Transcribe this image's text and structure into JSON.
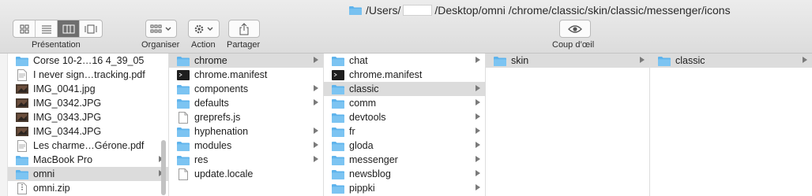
{
  "window": {
    "path_part1": "/Users/",
    "path_part2": "/Desktop/omni /chrome/classic/skin/classic/messenger/icons"
  },
  "toolbar": {
    "presentation_label": "Présentation",
    "organiser_label": "Organiser",
    "action_label": "Action",
    "partager_label": "Partager",
    "quicklook_label": "Coup d’œil"
  },
  "columns": [
    {
      "items": [
        {
          "label": "Corse 10-2…16 4_39_05",
          "icon": "folder-icon",
          "arrow": false,
          "selected": false
        },
        {
          "label": "I never sign…tracking.pdf",
          "icon": "pdf-icon",
          "arrow": false,
          "selected": false
        },
        {
          "label": "IMG_0041.jpg",
          "icon": "image-icon",
          "arrow": false,
          "selected": false
        },
        {
          "label": "IMG_0342.JPG",
          "icon": "image-icon",
          "arrow": false,
          "selected": false
        },
        {
          "label": "IMG_0343.JPG",
          "icon": "image-icon",
          "arrow": false,
          "selected": false
        },
        {
          "label": "IMG_0344.JPG",
          "icon": "image-icon",
          "arrow": false,
          "selected": false
        },
        {
          "label": "Les charme…Gérone.pdf",
          "icon": "pdf-icon",
          "arrow": false,
          "selected": false
        },
        {
          "label": "MacBook Pro",
          "icon": "folder-icon",
          "arrow": true,
          "selected": false
        },
        {
          "label": "omni",
          "icon": "folder-icon",
          "arrow": true,
          "selected": true
        },
        {
          "label": "omni.zip",
          "icon": "zip-icon",
          "arrow": false,
          "selected": false
        }
      ]
    },
    {
      "items": [
        {
          "label": "chrome",
          "icon": "folder-icon",
          "arrow": true,
          "selected": true
        },
        {
          "label": "chrome.manifest",
          "icon": "terminal-icon",
          "arrow": false,
          "selected": false
        },
        {
          "label": "components",
          "icon": "folder-icon",
          "arrow": true,
          "selected": false
        },
        {
          "label": "defaults",
          "icon": "folder-icon",
          "arrow": true,
          "selected": false
        },
        {
          "label": "greprefs.js",
          "icon": "document-icon",
          "arrow": false,
          "selected": false
        },
        {
          "label": "hyphenation",
          "icon": "folder-icon",
          "arrow": true,
          "selected": false
        },
        {
          "label": "modules",
          "icon": "folder-icon",
          "arrow": true,
          "selected": false
        },
        {
          "label": "res",
          "icon": "folder-icon",
          "arrow": true,
          "selected": false
        },
        {
          "label": "update.locale",
          "icon": "document-icon",
          "arrow": false,
          "selected": false
        }
      ]
    },
    {
      "items": [
        {
          "label": "chat",
          "icon": "folder-icon",
          "arrow": true,
          "selected": false
        },
        {
          "label": "chrome.manifest",
          "icon": "terminal-icon",
          "arrow": false,
          "selected": false
        },
        {
          "label": "classic",
          "icon": "folder-icon",
          "arrow": true,
          "selected": true
        },
        {
          "label": "comm",
          "icon": "folder-icon",
          "arrow": true,
          "selected": false
        },
        {
          "label": "devtools",
          "icon": "folder-icon",
          "arrow": true,
          "selected": false
        },
        {
          "label": "fr",
          "icon": "folder-icon",
          "arrow": true,
          "selected": false
        },
        {
          "label": "gloda",
          "icon": "folder-icon",
          "arrow": true,
          "selected": false
        },
        {
          "label": "messenger",
          "icon": "folder-icon",
          "arrow": true,
          "selected": false
        },
        {
          "label": "newsblog",
          "icon": "folder-icon",
          "arrow": true,
          "selected": false
        },
        {
          "label": "pippki",
          "icon": "folder-icon",
          "arrow": true,
          "selected": false
        }
      ]
    },
    {
      "items": [
        {
          "label": "skin",
          "icon": "folder-icon",
          "arrow": true,
          "selected": true
        }
      ]
    },
    {
      "items": [
        {
          "label": "classic",
          "icon": "folder-icon",
          "arrow": true,
          "selected": true
        }
      ]
    }
  ],
  "colors": {
    "folder": "#5eb3ec",
    "selection_gray": "#dcdcdc"
  }
}
